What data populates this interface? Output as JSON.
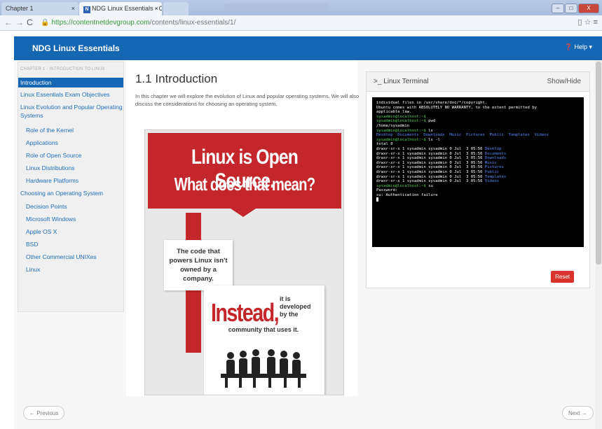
{
  "browser": {
    "tabs": [
      {
        "label": "Chapter 1"
      },
      {
        "label": "NDG Linux Essentials - Ch"
      }
    ],
    "url_host": "https://contentnetdevgroup.com",
    "url_path": "/contents/linux-essentials/1/"
  },
  "header": {
    "brand": "NDG Linux Essentials",
    "help": "Help"
  },
  "sidebar": {
    "chapter": "CHAPTER 1 - INTRODUCTION TO LINUX",
    "items": [
      {
        "label": "Introduction"
      },
      {
        "label": "Linux Essentials Exam Objectives"
      },
      {
        "label": "Linux Evolution and Popular Operating"
      },
      {
        "label": "Systems"
      },
      {
        "label": "Role of the Kernel"
      },
      {
        "label": "Applications"
      },
      {
        "label": "Role of Open Source"
      },
      {
        "label": "Linux Distributions"
      },
      {
        "label": "Hardware Platforms"
      },
      {
        "label": "Choosing an Operating System"
      },
      {
        "label": "Decision Points"
      },
      {
        "label": "Microsoft Windows"
      },
      {
        "label": "Apple OS X"
      },
      {
        "label": "BSD"
      },
      {
        "label": "Other Commercial UNIXes"
      },
      {
        "label": "Linux"
      }
    ]
  },
  "main": {
    "title": "1.1 Introduction",
    "intro": "In this chapter we will explore the evolution of Linux and popular operating systems. We will also discuss the considerations for choosing an operating system.",
    "poster": {
      "line1": "Linux is Open Source.",
      "line2": "What does that mean?",
      "box1": "The code that powers Linux isn't owned by a company.",
      "instead": "Instead,",
      "side1": "it is",
      "side2": "developed",
      "side3": "by the",
      "tail": "community that uses it."
    }
  },
  "terminal": {
    "title": "Linux Terminal",
    "showhide": "Show/Hide",
    "reset": "Reset",
    "lines": [
      "individual files in /usr/share/doc/*/copyright.",
      "",
      "Ubuntu comes with ABSOLUTELY NO WARRANTY, to the extent permitted by",
      "applicable law.",
      ""
    ],
    "prompt": "sysadmin@localhost:~$",
    "cmd_pwd": " pwd",
    "out_pwd": "/home/sysadmin",
    "cmd_ls": " ls",
    "ls_out": "Desktop  Documents  Downloads  Music  Pictures  Public  Templates  Videos",
    "cmd_lsl": " ls -l",
    "total": "total 0",
    "dir_prefix": "drwxr-xr-x 1 sysadmin sysadmin 0 Jul  3 05:56 ",
    "dirs": [
      "Desktop",
      "Documents",
      "Downloads",
      "Music",
      "Pictures",
      "Public",
      "Templates",
      "Videos"
    ],
    "cmd_su": " su",
    "password": "Password:",
    "auth_fail": "su: Authentication failure"
  },
  "footer": {
    "prev": "← Previous",
    "next": "Next →"
  }
}
